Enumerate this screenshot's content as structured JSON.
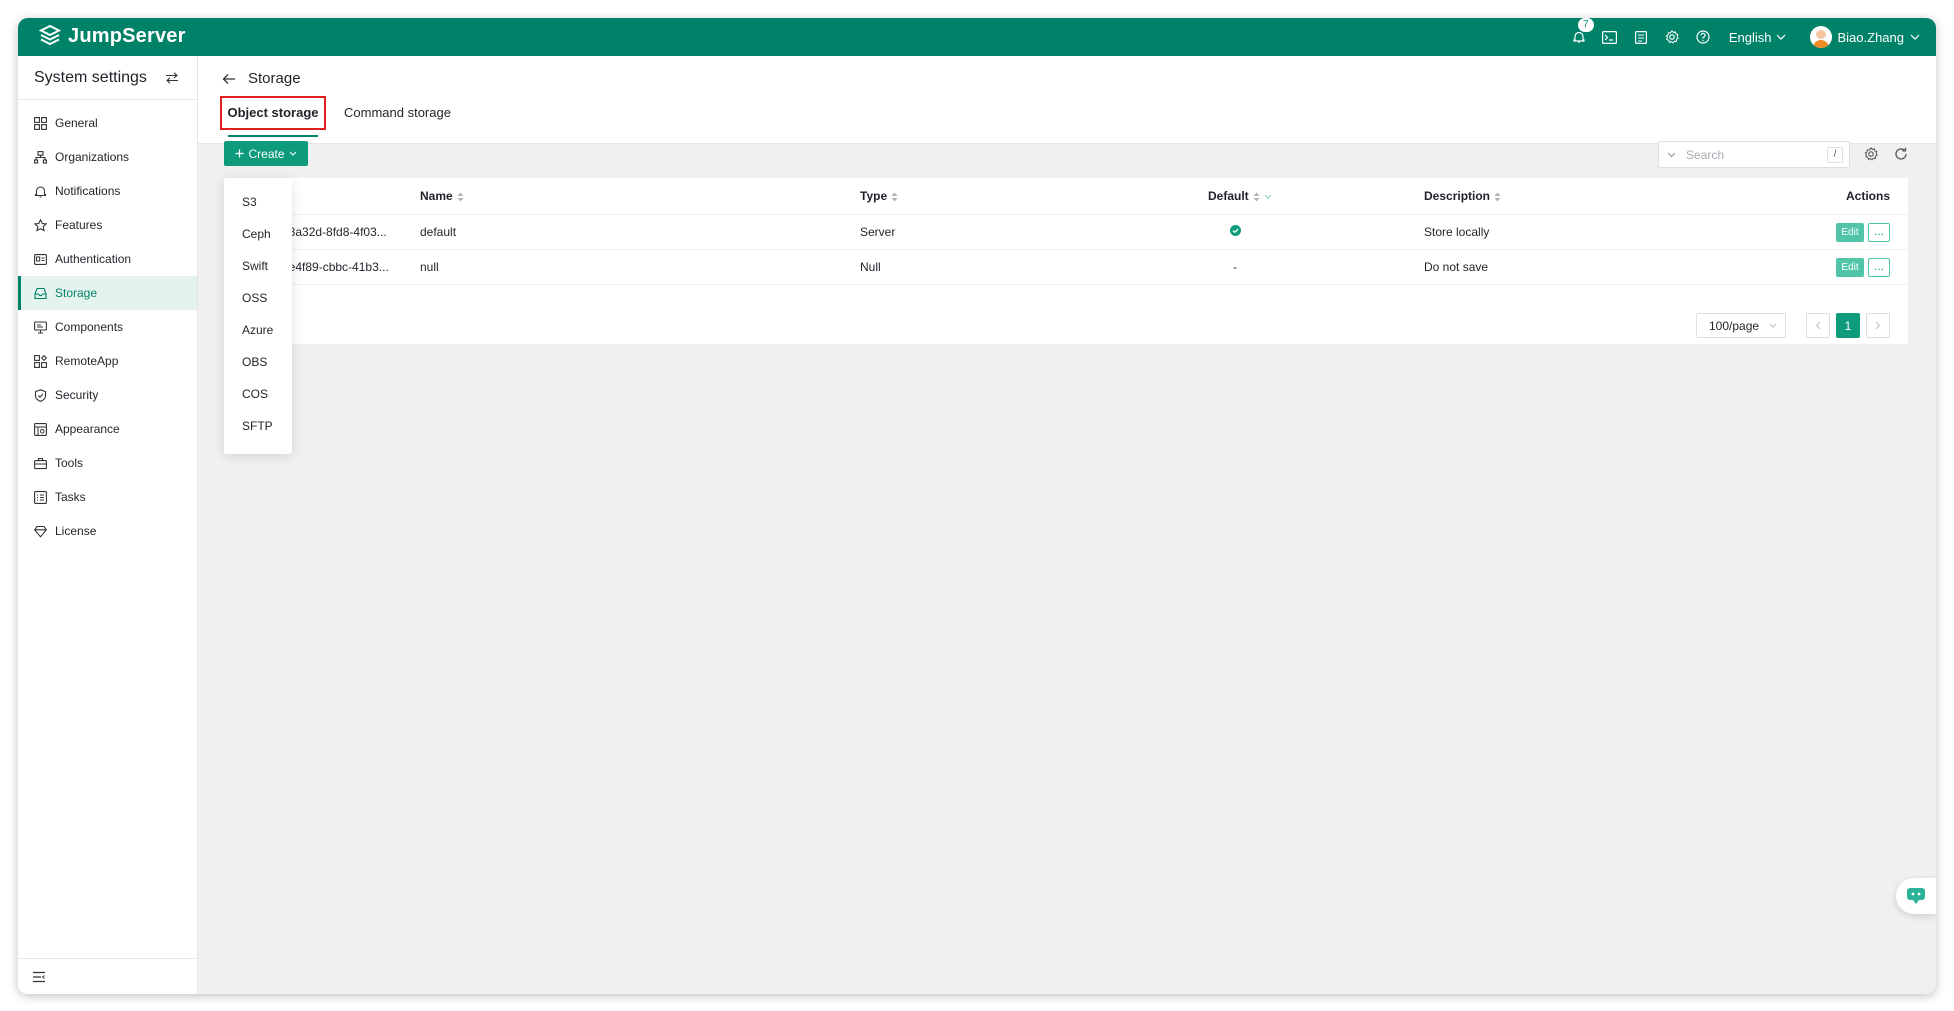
{
  "app": {
    "brand": "JumpServer",
    "notification_count": "7",
    "language": "English",
    "user_name": "Biao.Zhang",
    "accent_color": "#008268"
  },
  "sidebar": {
    "title": "System settings",
    "items": [
      {
        "label": "General",
        "icon": "grid-icon"
      },
      {
        "label": "Organizations",
        "icon": "org-icon"
      },
      {
        "label": "Notifications",
        "icon": "bell-icon"
      },
      {
        "label": "Features",
        "icon": "star-icon"
      },
      {
        "label": "Authentication",
        "icon": "id-card-icon"
      },
      {
        "label": "Storage",
        "icon": "storage-icon",
        "active": true
      },
      {
        "label": "Components",
        "icon": "monitor-icon"
      },
      {
        "label": "RemoteApp",
        "icon": "apps-icon"
      },
      {
        "label": "Security",
        "icon": "shield-icon"
      },
      {
        "label": "Appearance",
        "icon": "palette-icon"
      },
      {
        "label": "Tools",
        "icon": "toolbox-icon"
      },
      {
        "label": "Tasks",
        "icon": "tasks-icon"
      },
      {
        "label": "License",
        "icon": "diamond-icon"
      }
    ]
  },
  "page": {
    "title": "Storage",
    "tabs": [
      {
        "label": "Object storage",
        "active": true
      },
      {
        "label": "Command storage",
        "active": false
      }
    ]
  },
  "toolbar": {
    "create_label": "Create",
    "search_placeholder": "Search",
    "search_shortcut": "/"
  },
  "create_menu": {
    "options": [
      "S3",
      "Ceph",
      "Swift",
      "OSS",
      "Azure",
      "OBS",
      "COS",
      "SFTP"
    ]
  },
  "table": {
    "columns": {
      "name": "Name",
      "type": "Type",
      "default": "Default",
      "description": "Description",
      "actions": "Actions"
    },
    "rows": [
      {
        "id": "28a32d-8fd8-4f03...",
        "name": "default",
        "type": "Server",
        "default": "yes",
        "description": "Store locally",
        "edit": "Edit",
        "more": "..."
      },
      {
        "id": "9e4f89-cbbc-41b3...",
        "name": "null",
        "type": "Null",
        "default": "-",
        "description": "Do not save",
        "edit": "Edit",
        "more": "..."
      }
    ]
  },
  "pagination": {
    "page_size": "100/page",
    "current_page": "1"
  }
}
